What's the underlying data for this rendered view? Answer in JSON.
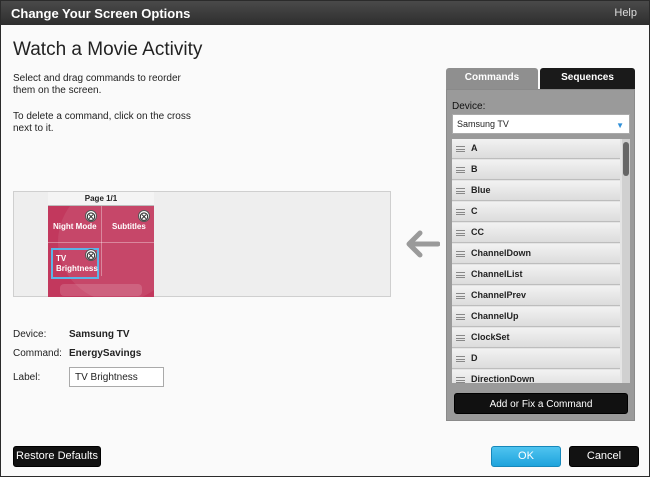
{
  "titlebar": {
    "title": "Change Your Screen Options",
    "help": "Help"
  },
  "heading": "Watch a Movie Activity",
  "instructions": {
    "reorder": "Select and drag commands to reorder them on the screen.",
    "delete": "To delete a command, click on the cross next to it."
  },
  "preview": {
    "page_label": "Page 1/1",
    "commands": [
      "Night Mode",
      "Subtitles",
      "TV Brightness"
    ],
    "delete_glyph": "⨂"
  },
  "details": {
    "device_label": "Device:",
    "device_value": "Samsung TV",
    "command_label": "Command:",
    "command_value": "EnergySavings",
    "label_label": "Label:",
    "label_value": "TV Brightness"
  },
  "panel": {
    "tabs": [
      "Commands",
      "Sequences"
    ],
    "active_tab": "Sequences",
    "device_label": "Device:",
    "device_selected": "Samsung TV",
    "commands": [
      "A",
      "B",
      "Blue",
      "C",
      "CC",
      "ChannelDown",
      "ChannelList",
      "ChannelPrev",
      "ChannelUp",
      "ClockSet",
      "D",
      "DirectionDown"
    ],
    "add_button": "Add or Fix a Command"
  },
  "footer": {
    "restore": "Restore Defaults",
    "ok": "OK",
    "cancel": "Cancel"
  },
  "colors": {
    "accent": "#1ea3dc",
    "page_bg": "#c2385d",
    "selected_outline": "#5bb4e6"
  }
}
